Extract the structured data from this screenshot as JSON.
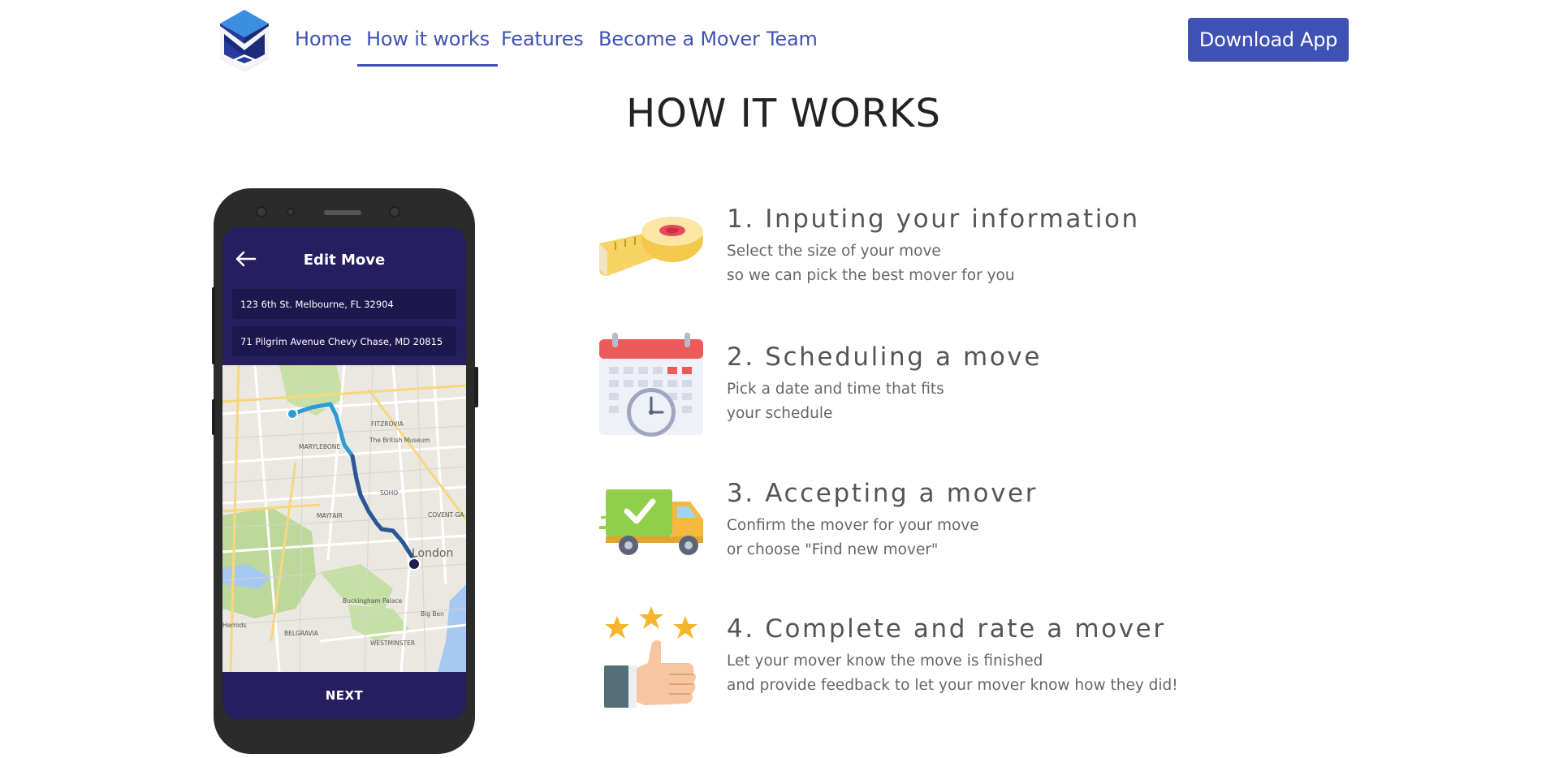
{
  "nav": {
    "links": [
      "Home",
      "How it works",
      "Features",
      "Become a Mover",
      "Team"
    ],
    "active": "How it works",
    "download_label": "Download App"
  },
  "colors": {
    "brand": "#3f51b5",
    "phone_screen": "#261e5e",
    "title": "#222222",
    "step_text": "#555555"
  },
  "page": {
    "title": "HOW IT WORKS"
  },
  "phone": {
    "screen_title": "Edit Move",
    "from_address": "123 6th St. Melbourne, FL 32904",
    "to_address": "71 Pilgrim Avenue Chevy Chase, MD 20815",
    "next_label": "NEXT",
    "map_labels": {
      "fitzrovia": "FITZROVIA",
      "british_museum": "The British Museum",
      "marylebone": "MARYLEBONE",
      "soho": "SOHO",
      "mayfair": "MAYFAIR",
      "covent_garden": "COVENT GA",
      "london": "London",
      "buckingham": "Buckingham Palace",
      "big_ben": "Big Ben",
      "harrods": "Harrods",
      "belgravia": "BELGRAVIA",
      "westminster": "WESTMINSTER"
    }
  },
  "steps": [
    {
      "title": "1. Inputing your information",
      "line1": "Select the size of your move",
      "line2": "so we can pick the best mover for you",
      "icon": "tape-measure-icon"
    },
    {
      "title": "2. Scheduling a move",
      "line1": "Pick a date and time that fits",
      "line2": "your schedule",
      "icon": "calendar-clock-icon"
    },
    {
      "title": "3. Accepting a mover",
      "line1": "Confirm the mover for your move",
      "line2": "or choose \"Find new mover\"",
      "icon": "delivery-truck-icon"
    },
    {
      "title": "4. Complete and rate a mover",
      "line1": "Let your mover know the move is finished",
      "line2": "and provide feedback to let your mover know how they did!",
      "icon": "thumbs-up-stars-icon"
    }
  ]
}
